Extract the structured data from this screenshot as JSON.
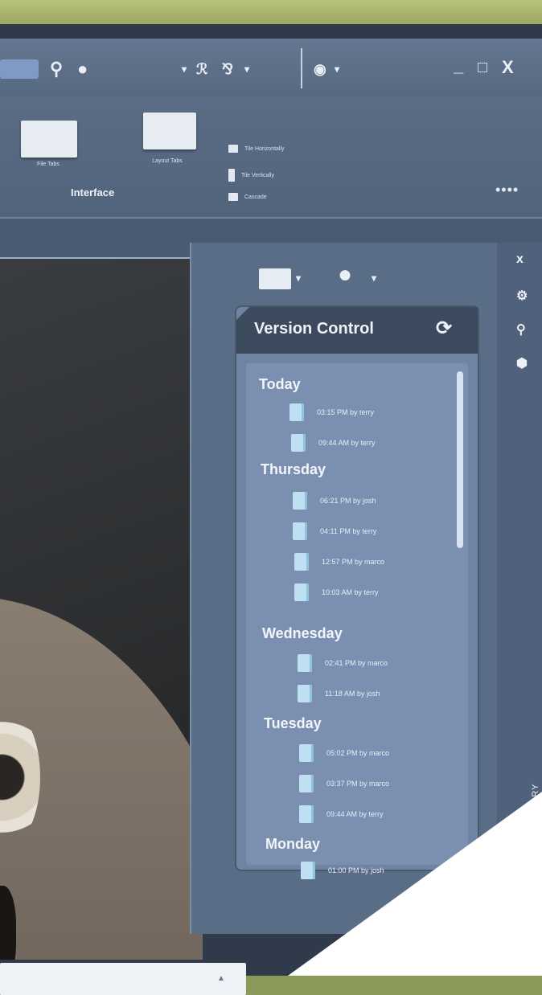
{
  "toolbar": {
    "window_controls": [
      "_",
      "□",
      "X"
    ]
  },
  "ribbon": {
    "file_tabs_label": "File Tabs",
    "layout_tabs_label": "Layout Tabs",
    "group_label": "Interface",
    "tile_horizontally": "Tile Horizontally",
    "tile_vertically": "Tile Vertically",
    "cascade": "Cascade",
    "more": "••••"
  },
  "panel": {
    "close": "x",
    "title": "Version Control",
    "history_label": "HISTORY",
    "groups": [
      {
        "day": "Today",
        "entries": [
          "03:15 PM by terry",
          "09:44 AM by terry"
        ]
      },
      {
        "day": "Thursday",
        "entries": [
          "06:21 PM by josh",
          "04:11 PM by terry",
          "12:57 PM by marco",
          "10:03 AM by terry"
        ]
      },
      {
        "day": "Wednesday",
        "entries": [
          "02:41 PM by marco",
          "11:18 AM by josh"
        ]
      },
      {
        "day": "Tuesday",
        "entries": [
          "05:02 PM by marco",
          "03:37 PM by marco",
          "09:44 AM by terry"
        ]
      },
      {
        "day": "Monday",
        "entries": [
          "01:00 PM by josh"
        ]
      }
    ]
  },
  "colors": {
    "panel_bg": "#5a6d87",
    "header_bg": "#3c4a5e",
    "list_bg": "#7b90b0",
    "doc_icon": "#bfe0f2"
  }
}
